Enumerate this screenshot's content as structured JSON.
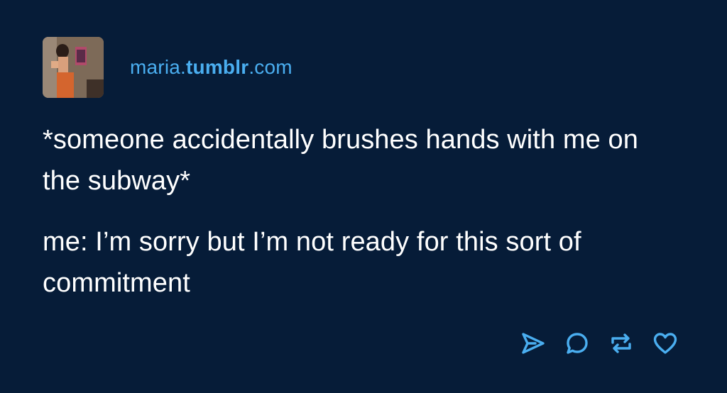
{
  "post": {
    "blog": {
      "name_prefix": "maria.",
      "name_brand": "tumblr",
      "name_suffix": ".com"
    },
    "paragraphs": [
      "*someone accidentally brushes hands with me on the subway*",
      "me: I’m sorry but I’m not ready for this sort of commitment"
    ],
    "actions": [
      {
        "icon": "send-icon"
      },
      {
        "icon": "reply-icon"
      },
      {
        "icon": "reblog-icon"
      },
      {
        "icon": "like-icon"
      }
    ]
  },
  "colors": {
    "background": "#061c38",
    "accent": "#4aaef0",
    "text": "#ffffff"
  }
}
